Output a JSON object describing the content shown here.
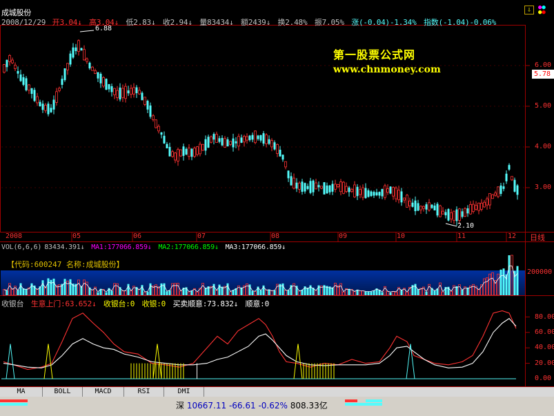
{
  "stock": {
    "name": "成城股份",
    "date": "2008/12/29",
    "open_label": "开",
    "open": "3.04",
    "high_label": "高",
    "high": "3.04",
    "low_label": "低",
    "low": "2.83",
    "close_label": "收",
    "close": "2.94",
    "vol_label": "量",
    "vol": "83434",
    "amt_label": "额",
    "amt": "2439",
    "turn_label": "换",
    "turn": "2.48%",
    "amp_label": "振",
    "amp": "7.05%",
    "chg_label": "涨",
    "chg": "(-0.04)-1.34%",
    "idx_label": "指数",
    "idx": "(-1.04)-0.06%",
    "peak_label": "6.88",
    "trough_label": "2.10",
    "price_tag": "5.78"
  },
  "watermark": {
    "line1": "第一股票公式网",
    "line2": "www.chnmoney.com"
  },
  "price_axis": [
    "6.00",
    "5.00",
    "4.00",
    "3.00"
  ],
  "month_axis": [
    "2008",
    "05",
    "06",
    "07",
    "08",
    "09",
    "10",
    "11",
    "12"
  ],
  "period": "日线",
  "volume_panel": {
    "title": "VOL(6,6,6)",
    "vol": "83434.391",
    "ma1_label": "MA1:",
    "ma1": "177066.859",
    "ma2_label": "MA2:",
    "ma2": "177066.859",
    "ma3_label": "MA3:",
    "ma3": "177066.859",
    "code_info": "【代码:600247 名称:成城股份】",
    "axis_label": "200000"
  },
  "indicator_panel": {
    "title": "收银台",
    "l1_label": "生意上门:",
    "l1": "63.652",
    "l2_label": "收银台:",
    "l2": "0",
    "l3_label": "收银:",
    "l3": "0",
    "l4_label": "买卖顺意:",
    "l4": "73.832",
    "l5_label": "顺意:",
    "l5": "0",
    "axis": [
      "80.00",
      "60.00",
      "40.00",
      "20.00",
      "0.00"
    ]
  },
  "tabs": [
    "MA",
    "BOLL",
    "MACD",
    "RSI",
    "DMI"
  ],
  "statusbar": {
    "market": "深",
    "index": "10667.11",
    "change": "-66.61",
    "pct": "-0.62%",
    "amount": "808.33亿"
  },
  "colors": {
    "up": "#ff3232",
    "down": "#54fcfc",
    "white": "#ffffff",
    "yellow": "#ffff00",
    "magenta": "#ff00ff",
    "green": "#00ff00"
  }
}
